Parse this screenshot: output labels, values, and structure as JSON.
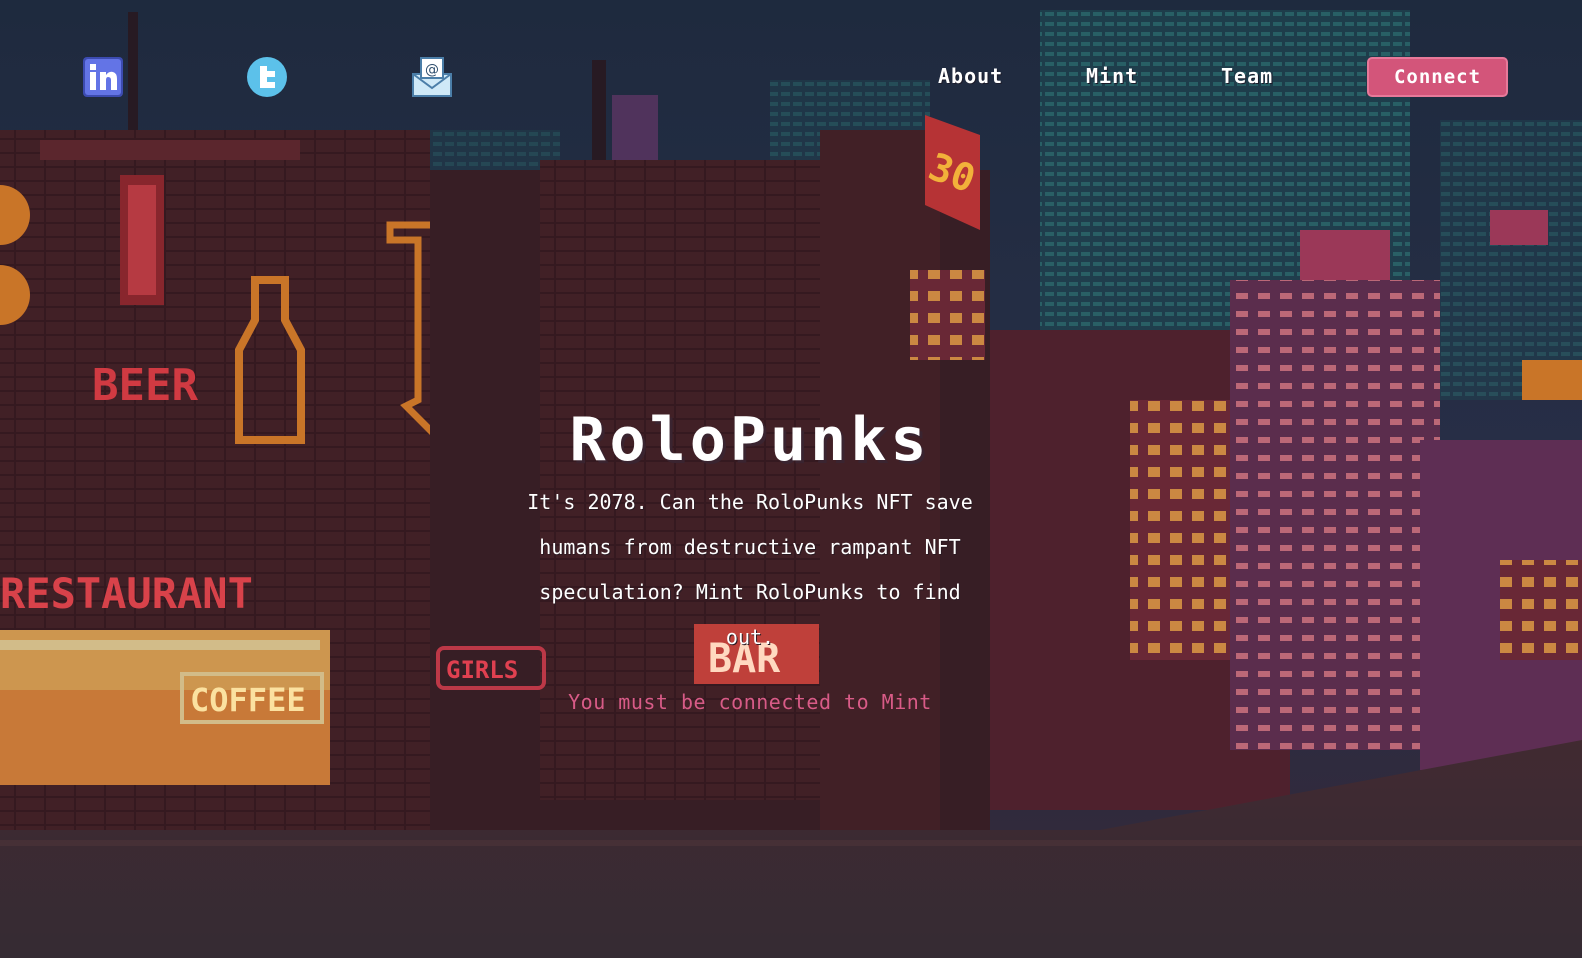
{
  "nav": {
    "social": [
      {
        "name": "linkedin",
        "icon": "linkedin-icon"
      },
      {
        "name": "twitter",
        "icon": "twitter-icon"
      },
      {
        "name": "email",
        "icon": "email-icon"
      }
    ],
    "links": [
      {
        "label": "About"
      },
      {
        "label": "Mint"
      },
      {
        "label": "Team"
      }
    ],
    "connect_label": "Connect"
  },
  "hero": {
    "title": "RoloPunks",
    "description": "It's 2078. Can the RoloPunks NFT save humans from destructive rampant NFT speculation? Mint RoloPunks to find out.",
    "mint_status": "You must be connected to Mint"
  },
  "scene": {
    "signs": {
      "beer": "BEER",
      "restaurant": "RESTAURANT",
      "coffee": "COFFEE",
      "girls": "GIRLS",
      "bar": "BAR",
      "thirty": "30"
    }
  },
  "colors": {
    "accent": "#d3557a",
    "mint_status": "#d85b87",
    "sky": "#22324a",
    "neon_orange": "#f08a2a",
    "neon_red": "#c8343a"
  }
}
